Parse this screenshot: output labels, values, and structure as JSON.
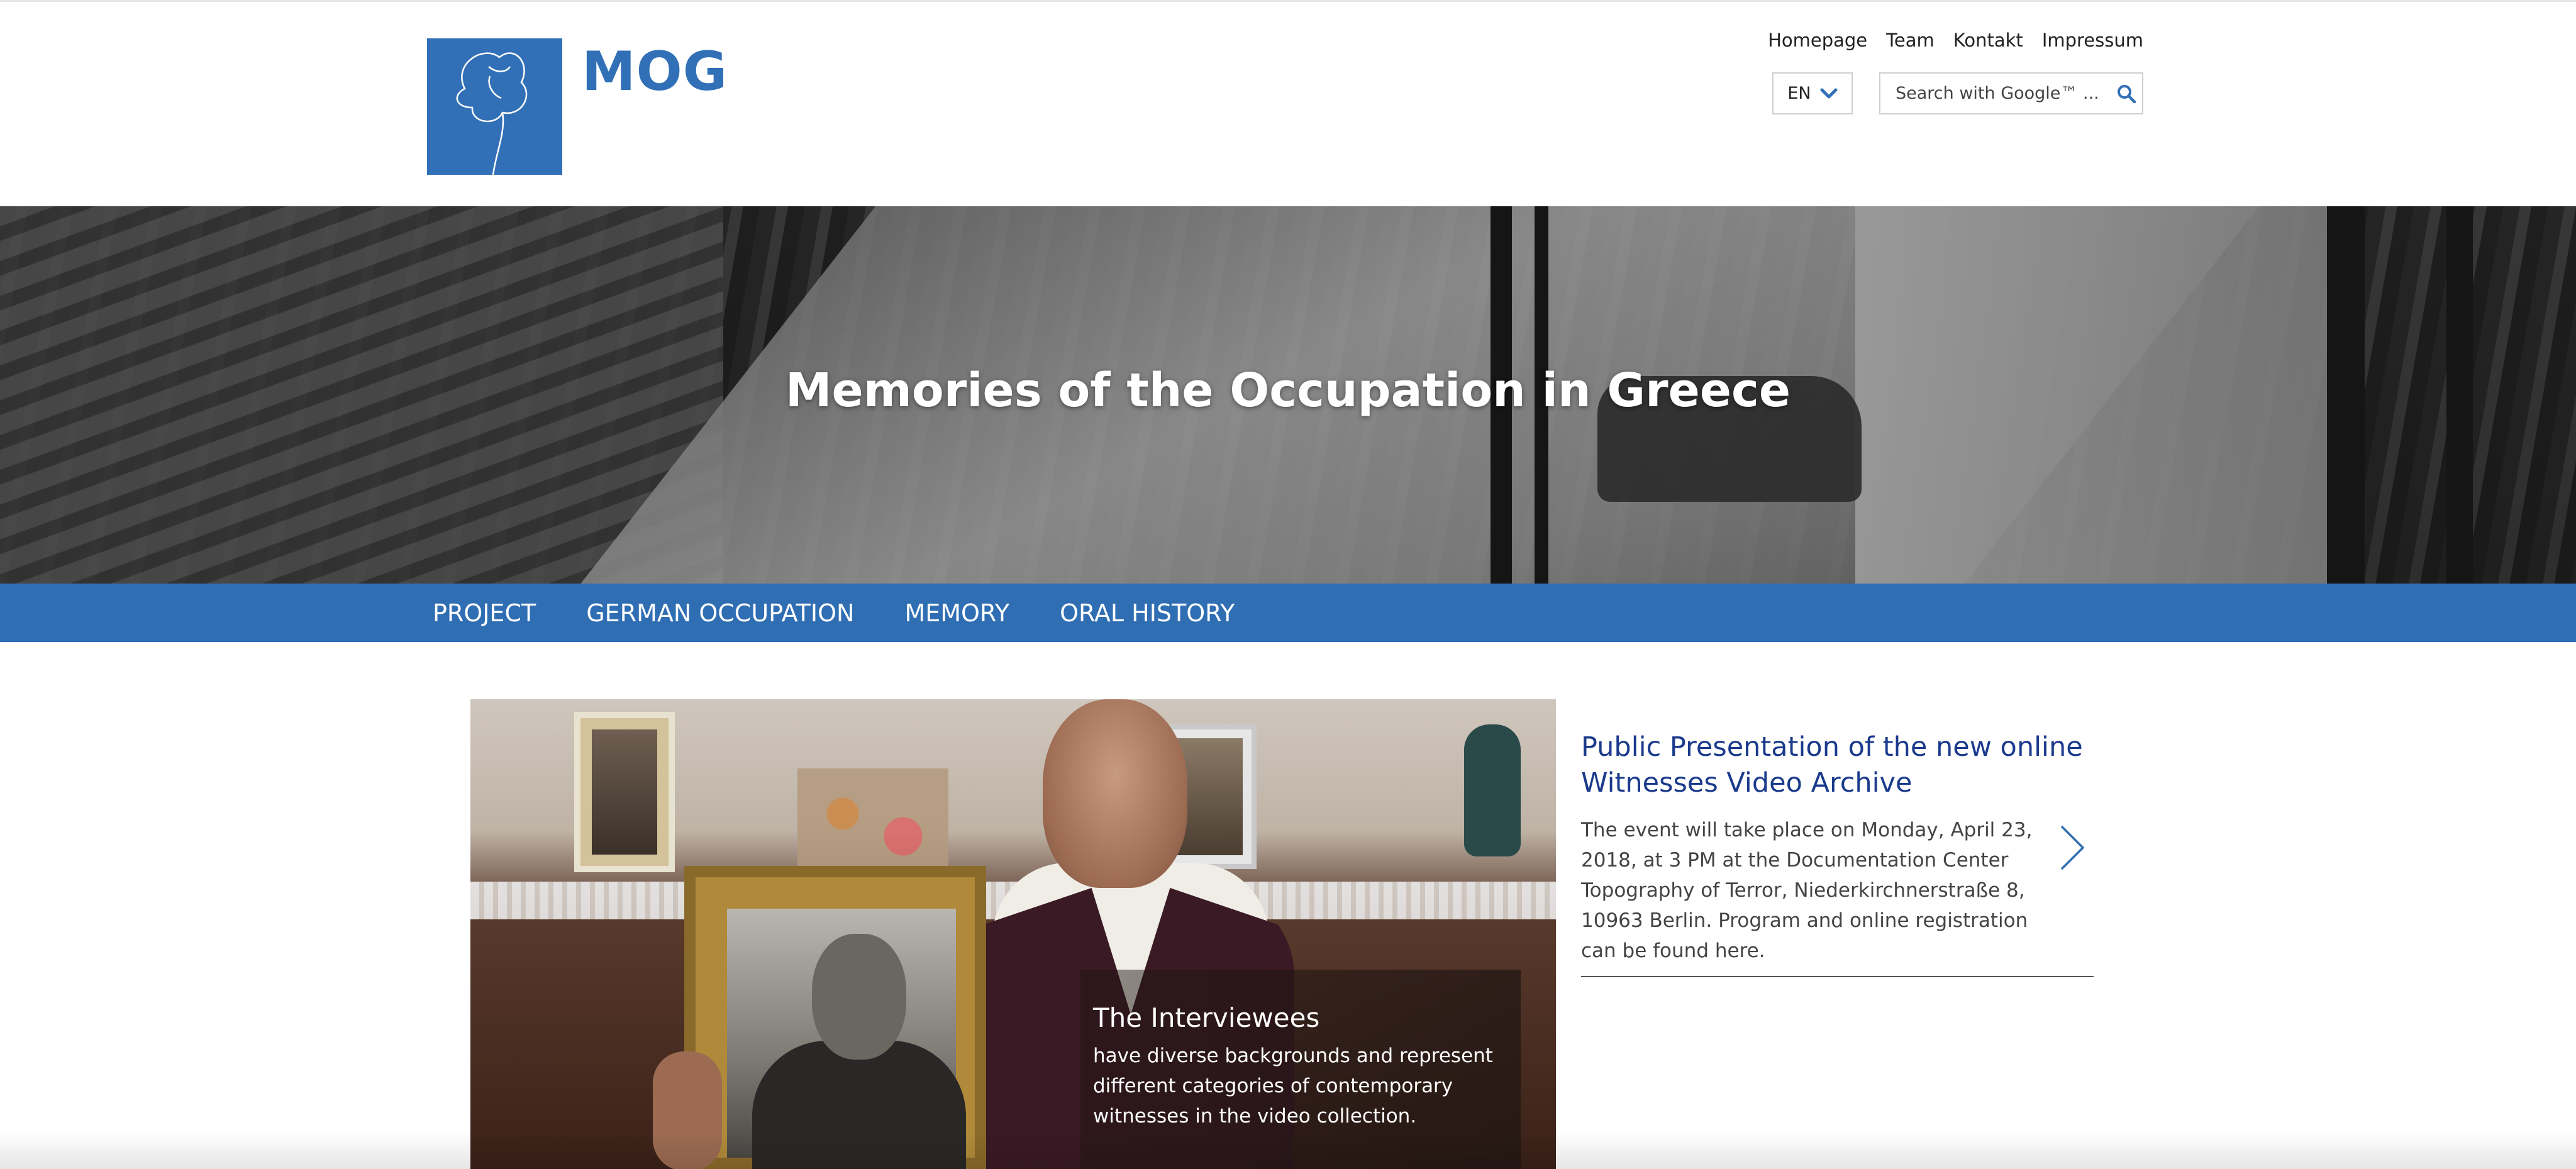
{
  "header": {
    "brand": "MOG",
    "logo_icon": "poppy-flower-icon",
    "topnav": [
      "Homepage",
      "Team",
      "Kontakt",
      "Impressum"
    ],
    "language": {
      "selected": "EN",
      "icon": "chevron-down-icon"
    },
    "search": {
      "placeholder": "Search with Google™ ...",
      "value": "",
      "icon": "search-icon"
    }
  },
  "hero": {
    "title": "Memories of the Occupation in Greece"
  },
  "mainnav": {
    "items": [
      "PROJECT",
      "GERMAN OCCUPATION",
      "MEMORY",
      "ORAL HISTORY"
    ]
  },
  "teaser": {
    "caption_title": "The Interviewees",
    "caption_text": "have diverse backgrounds and represent different categories of contemporary witnesses in the video collection."
  },
  "news": {
    "title": "Public Presentation of the new online Witnesses Video Archive",
    "text": "The event will take place on Monday, April 23, 2018, at 3 PM at the Documentation Center Topography of Terror, Niederkirchnerstraße 8, 10963 Berlin. Program and online registration can be found here.",
    "next_icon": "chevron-right-icon"
  },
  "colors": {
    "brand_blue": "#3170b6",
    "nav_blue": "#2f6eb3",
    "link_dark_blue": "#1a3a8c"
  }
}
